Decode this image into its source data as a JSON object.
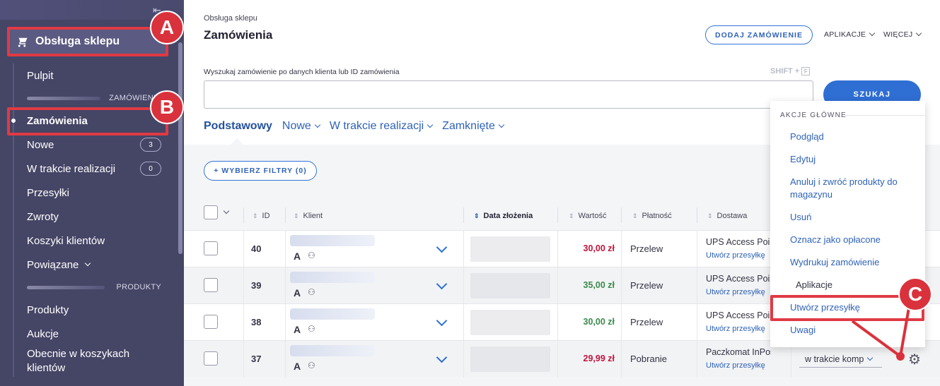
{
  "sidebar": {
    "shop_label": "Obsługa sklepu",
    "items": [
      {
        "label": "Pulpit"
      },
      {
        "section": "ZAMÓWIENIA"
      },
      {
        "label": "Zamówienia",
        "active": true
      },
      {
        "label": "Nowe",
        "badge": "3"
      },
      {
        "label": "W trakcie realizacji",
        "badge": "0"
      },
      {
        "label": "Przesyłki"
      },
      {
        "label": "Zwroty"
      },
      {
        "label": "Koszyki klientów"
      },
      {
        "label": "Powiązane",
        "dropdown": true
      },
      {
        "section": "PRODUKTY"
      },
      {
        "label": "Produkty"
      },
      {
        "label": "Aukcje"
      },
      {
        "label": "Obecnie w koszykach klientów"
      }
    ]
  },
  "header": {
    "breadcrumb": "Obsługa sklepu",
    "title": "Zamówienia",
    "add_order": "DODAJ ZAMÓWIENIE",
    "apps": "APLIKACJE",
    "more": "WIĘCEJ"
  },
  "search": {
    "label": "Wyszukaj zamówienie po danych klienta lub ID zamówienia",
    "shortcut": "SHIFT +",
    "shortcut_key": "F",
    "button": "SZUKAJ",
    "value": ""
  },
  "tabs": [
    {
      "label": "Podstawowy",
      "active": true
    },
    {
      "label": "Nowe"
    },
    {
      "label": "W trakcie realizacji"
    },
    {
      "label": "Zamknięte"
    }
  ],
  "filters_button": "+ WYBIERZ FILTRY (0)",
  "table": {
    "headers": {
      "id": "ID",
      "client": "Klient",
      "date": "Data złożenia",
      "value": "Wartość",
      "payment": "Płatność",
      "delivery": "Dostawa"
    },
    "rows": [
      {
        "id": "40",
        "value": "30,00 zł",
        "value_color": "#c4123c",
        "payment": "Przelew",
        "delivery": "UPS Access Point",
        "ship": "Utwórz przesyłkę",
        "client_initial": "A"
      },
      {
        "id": "39",
        "value": "35,00 zł",
        "value_color": "#3a8a4a",
        "payment": "Przelew",
        "delivery": "UPS Access Point",
        "ship": "Utwórz przesyłkę",
        "client_initial": "A"
      },
      {
        "id": "38",
        "value": "30,00 zł",
        "value_color": "#3a8a4a",
        "payment": "Przelew",
        "delivery": "UPS Access Point",
        "ship": "Utwórz przesyłkę",
        "client_initial": "A"
      },
      {
        "id": "37",
        "value": "29,99 zł",
        "value_color": "#c4123c",
        "payment": "Pobranie",
        "delivery": "Paczkomat InPost",
        "ship": "Utwórz przesyłkę",
        "client_initial": "A",
        "status": "w trakcie komp"
      }
    ]
  },
  "menu": {
    "title": "AKCJE GŁÓWNE",
    "items": [
      "Podgląd",
      "Edytuj",
      "Anuluj i zwróć produkty do magazynu",
      "Usuń",
      "Oznacz jako opłacone",
      "Wydrukuj zamówienie",
      "Aplikacje",
      "Utwórz przesyłkę",
      "Uwagi"
    ]
  },
  "callouts": [
    "A",
    "B",
    "C"
  ],
  "colors": {
    "accent": "#2f6fd4",
    "highlight": "#e03a44",
    "sidebar": "#454566"
  }
}
